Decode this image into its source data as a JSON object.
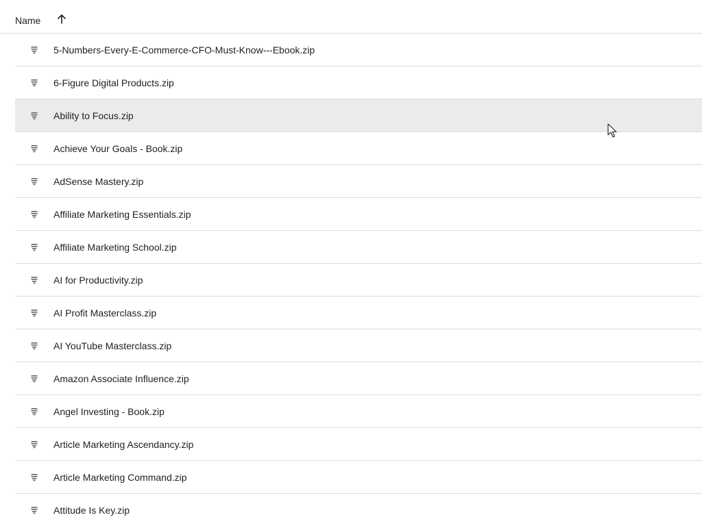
{
  "header": {
    "name_label": "Name",
    "sort_icon": "arrow-up-icon"
  },
  "files": [
    {
      "name": "5-Numbers-Every-E-Commerce-CFO-Must-Know---Ebook.zip",
      "icon": "zip-file-icon"
    },
    {
      "name": "6-Figure Digital Products.zip",
      "icon": "zip-file-icon"
    },
    {
      "name": "Ability to Focus.zip",
      "icon": "zip-file-icon",
      "hovered": true
    },
    {
      "name": "Achieve Your Goals - Book.zip",
      "icon": "zip-file-icon"
    },
    {
      "name": "AdSense Mastery.zip",
      "icon": "zip-file-icon"
    },
    {
      "name": "Affiliate Marketing Essentials.zip",
      "icon": "zip-file-icon"
    },
    {
      "name": "Affiliate Marketing School.zip",
      "icon": "zip-file-icon"
    },
    {
      "name": "AI for Productivity.zip",
      "icon": "zip-file-icon"
    },
    {
      "name": "AI Profit Masterclass.zip",
      "icon": "zip-file-icon"
    },
    {
      "name": "AI YouTube Masterclass.zip",
      "icon": "zip-file-icon"
    },
    {
      "name": "Amazon Associate Influence.zip",
      "icon": "zip-file-icon"
    },
    {
      "name": "Angel Investing - Book.zip",
      "icon": "zip-file-icon"
    },
    {
      "name": "Article Marketing Ascendancy.zip",
      "icon": "zip-file-icon"
    },
    {
      "name": "Article Marketing Command.zip",
      "icon": "zip-file-icon"
    },
    {
      "name": "Attitude Is Key.zip",
      "icon": "zip-file-icon"
    }
  ],
  "colors": {
    "row_hover": "#ebebeb",
    "divider": "#dadce0",
    "text": "#1f1f1f",
    "icon": "#5f6368"
  }
}
